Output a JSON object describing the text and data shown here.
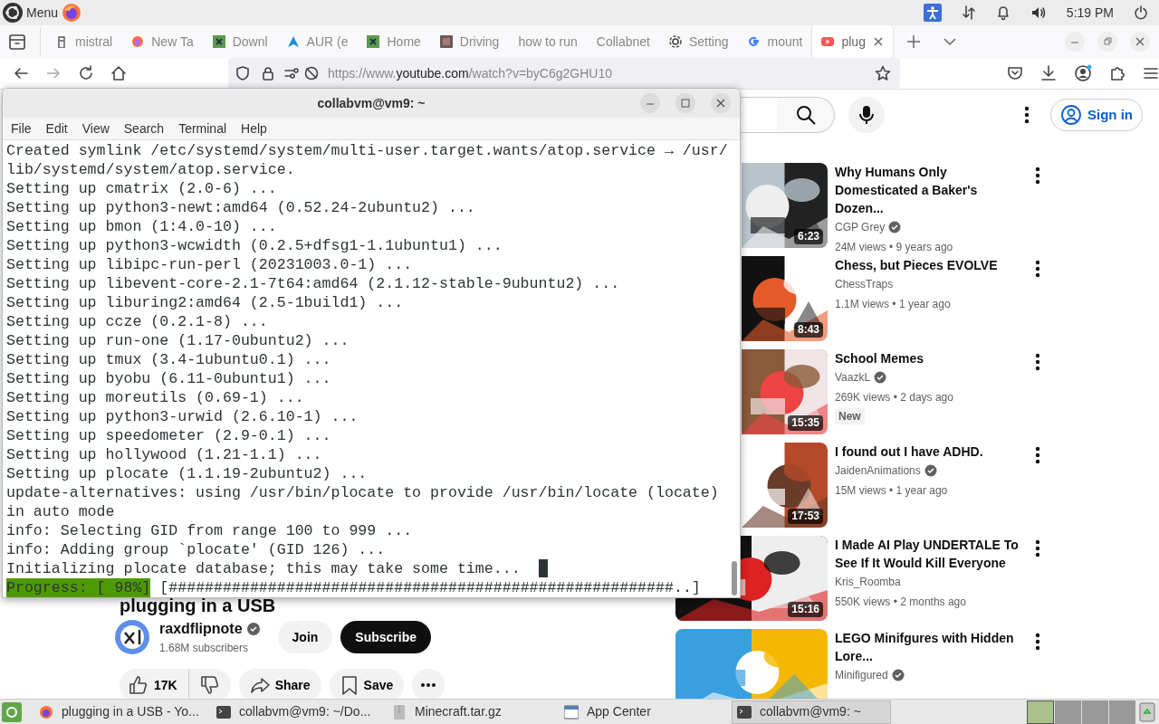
{
  "top_panel": {
    "menu_label": "Menu",
    "clock": "5:19 PM"
  },
  "browser": {
    "tabs": [
      {
        "label": "mistral",
        "selected": false
      },
      {
        "label": "New Ta",
        "selected": false
      },
      {
        "label": "Downl",
        "selected": false
      },
      {
        "label": "AUR (e",
        "selected": false
      },
      {
        "label": "Home",
        "selected": false
      },
      {
        "label": "Driving",
        "selected": false
      },
      {
        "label": "how to run",
        "selected": false
      },
      {
        "label": "Collabnet",
        "selected": false
      },
      {
        "label": "Setting",
        "selected": false
      },
      {
        "label": "mount",
        "selected": false
      },
      {
        "label": "plug",
        "selected": true
      }
    ],
    "url_prefix": "https://www.",
    "url_host": "youtube.com",
    "url_rest": "/watch?v=byC6g2GHU10"
  },
  "youtube": {
    "sign_in": "Sign in",
    "video_title": "plugging in a USB",
    "channel": "raxdflipnote",
    "subscribers": "1.68M subscribers",
    "join": "Join",
    "subscribe": "Subscribe",
    "likes": "17K",
    "share": "Share",
    "save": "Save",
    "videos": [
      {
        "title": "Why Humans Only Domesticated a Baker's Dozen...",
        "channel": "CGP Grey",
        "verified": true,
        "meta": "24M views • 9 years ago",
        "duration": "6:23"
      },
      {
        "title": "Chess, but Pieces EVOLVE",
        "channel": "ChessTraps",
        "verified": false,
        "meta": "1.1M views • 1 year ago",
        "duration": "8:43"
      },
      {
        "title": "School Memes",
        "channel": "VaazkL",
        "verified": true,
        "meta": "269K views • 2 days ago",
        "duration": "15:35",
        "badge": "New"
      },
      {
        "title": "I found out I have ADHD.",
        "channel": "JaidenAnimations",
        "verified": true,
        "meta": "15M views • 1 year ago",
        "duration": "17:53"
      },
      {
        "title": "I Made AI Play UNDERTALE To See If It Would Kill Everyone",
        "channel": "Kris_Roomba",
        "verified": false,
        "meta": "550K views • 2 months ago",
        "duration": "15:16"
      },
      {
        "title": "LEGO Minifgures with Hidden Lore...",
        "channel": "Minifigured",
        "verified": true
      }
    ]
  },
  "terminal": {
    "title": "collabvm@vm9: ~",
    "menu": [
      "File",
      "Edit",
      "View",
      "Search",
      "Terminal",
      "Help"
    ],
    "lines": [
      "Created symlink /etc/systemd/system/multi-user.target.wants/atop.service → /usr/",
      "lib/systemd/system/atop.service.",
      "Setting up cmatrix (2.0-6) ...",
      "Setting up python3-newt:amd64 (0.52.24-2ubuntu2) ...",
      "Setting up bmon (1:4.0-10) ...",
      "Setting up python3-wcwidth (0.2.5+dfsg1-1.1ubuntu1) ...",
      "Setting up libipc-run-perl (20231003.0-1) ...",
      "Setting up libevent-core-2.1-7t64:amd64 (2.1.12-stable-9ubuntu2) ...",
      "Setting up liburing2:amd64 (2.5-1build1) ...",
      "Setting up ccze (0.2.1-8) ...",
      "Setting up run-one (1.17-0ubuntu2) ...",
      "Setting up tmux (3.4-1ubuntu0.1) ...",
      "Setting up byobu (6.11-0ubuntu1) ...",
      "Setting up moreutils (0.69-1) ...",
      "Setting up python3-urwid (2.6.10-1) ...",
      "Setting up speedometer (2.9-0.1) ...",
      "Setting up hollywood (1.21-1.1) ...",
      "Setting up plocate (1.1.19-2ubuntu2) ...",
      "update-alternatives: using /usr/bin/plocate to provide /usr/bin/locate (locate)",
      "in auto mode",
      "info: Selecting GID from range 100 to 999 ...",
      "info: Adding group `plocate' (GID 126) ...",
      "Initializing plocate database; this may take some time..."
    ],
    "progress_label": "Progress: [ 98%]",
    "progress_bar": "[########################################################..]"
  },
  "taskbar": {
    "items": [
      {
        "label": "plugging in a USB - Yo...",
        "selected": false
      },
      {
        "label": "collabvm@vm9: ~/Do...",
        "selected": false
      },
      {
        "label": "Minecraft.tar.gz",
        "selected": false
      },
      {
        "label": "App Center",
        "selected": false
      },
      {
        "label": "collabvm@vm9: ~",
        "selected": true
      }
    ]
  }
}
